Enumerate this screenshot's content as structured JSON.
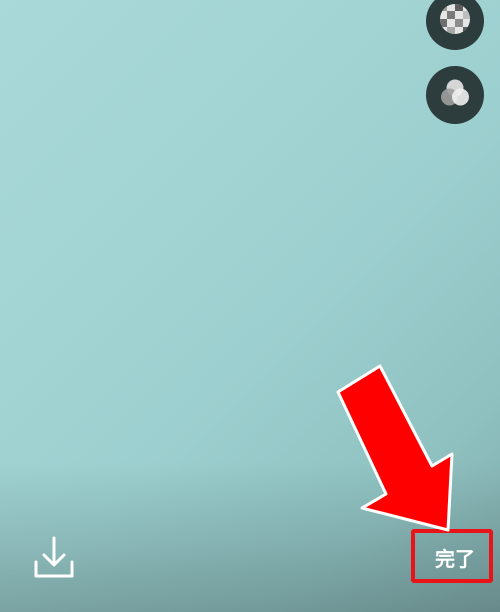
{
  "screen": {
    "background_color": "#a3d5d4"
  },
  "tools": {
    "mosaic": {
      "icon": "mosaic-icon"
    },
    "filter": {
      "icon": "filter-icon"
    }
  },
  "bottom_bar": {
    "download": {
      "icon": "download-icon"
    },
    "done_label": "完了"
  },
  "annotation": {
    "arrow_color": "#ff0000",
    "box_color": "#e8141a"
  }
}
